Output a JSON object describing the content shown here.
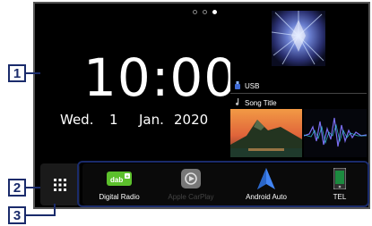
{
  "callouts": [
    "1",
    "2",
    "3"
  ],
  "clock": {
    "time_hours": "10",
    "time_sep": ":",
    "time_minutes": "00",
    "weekday": "Wed.",
    "day": "1",
    "month": "Jan.",
    "year": "2020"
  },
  "music": {
    "source": "USB",
    "title": "Song Title"
  },
  "apps": [
    {
      "label": "Digital Radio",
      "icon": "dab-plus-icon",
      "enabled": true
    },
    {
      "label": "Apple CarPlay",
      "icon": "carplay-icon",
      "enabled": false
    },
    {
      "label": "Android Auto",
      "icon": "android-auto-icon",
      "enabled": true
    },
    {
      "label": "TEL",
      "icon": "phone-icon",
      "enabled": true
    }
  ],
  "colors": {
    "callout": "#1a2b6b",
    "dab_green": "#5cc02c",
    "android_blue": "#4285f4"
  }
}
